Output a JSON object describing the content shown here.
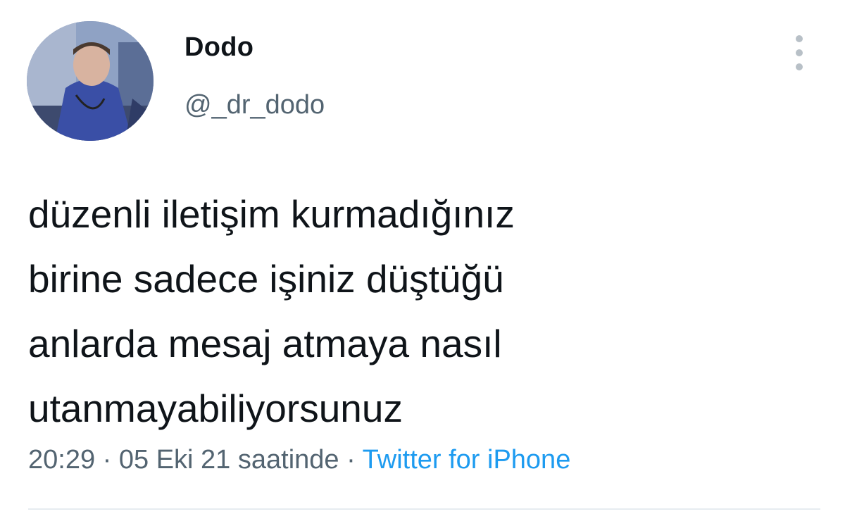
{
  "user": {
    "display_name": "Dodo",
    "handle": "@_dr_dodo"
  },
  "tweet": {
    "lines": [
      "düzenli iletişim kurmadığınız",
      "birine sadece işiniz düştüğü",
      "anlarda mesaj atmaya nasıl",
      "utanmayabiliyorsunuz"
    ],
    "time": "20:29",
    "separator": " · ",
    "date": "05 Eki 21 saatinde",
    "source": "Twitter for iPhone"
  },
  "colors": {
    "text": "#0f1419",
    "secondary": "#536471",
    "link": "#1d9bf0"
  },
  "icons": {
    "more": "more-vertical-icon"
  }
}
